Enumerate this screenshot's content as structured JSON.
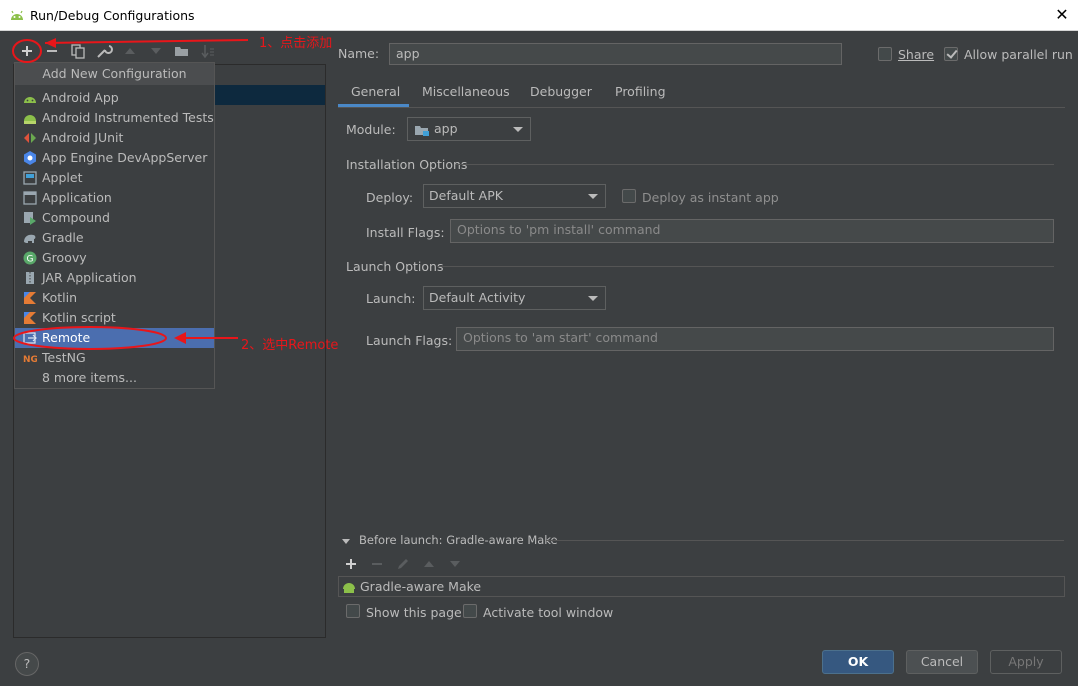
{
  "window": {
    "title": "Run/Debug Configurations",
    "close_icon": "close-icon"
  },
  "toolbar": {
    "icons": [
      "add-icon",
      "remove-icon",
      "copy-icon",
      "wrench-icon",
      "move-up-icon",
      "move-down-icon",
      "folder-icon",
      "sort-icon"
    ]
  },
  "popup": {
    "title": "Add New Configuration",
    "items": [
      {
        "label": "Android App",
        "icon": "android-icon"
      },
      {
        "label": "Android Instrumented Tests",
        "icon": "android-test-icon"
      },
      {
        "label": "Android JUnit",
        "icon": "junit-icon"
      },
      {
        "label": "App Engine DevAppServer",
        "icon": "app-engine-icon"
      },
      {
        "label": "Applet",
        "icon": "applet-icon"
      },
      {
        "label": "Application",
        "icon": "application-icon"
      },
      {
        "label": "Compound",
        "icon": "compound-icon"
      },
      {
        "label": "Gradle",
        "icon": "gradle-icon"
      },
      {
        "label": "Groovy",
        "icon": "groovy-icon"
      },
      {
        "label": "JAR Application",
        "icon": "jar-icon"
      },
      {
        "label": "Kotlin",
        "icon": "kotlin-icon"
      },
      {
        "label": "Kotlin script",
        "icon": "kotlin-script-icon"
      },
      {
        "label": "Remote",
        "icon": "remote-icon"
      },
      {
        "label": "TestNG",
        "icon": "testng-icon"
      },
      {
        "label": "8 more items...",
        "icon": ""
      }
    ]
  },
  "config": {
    "name_label": "Name:",
    "name_value": "app",
    "share_label": "Share",
    "allow_parallel_label": "Allow parallel run",
    "tabs": [
      "General",
      "Miscellaneous",
      "Debugger",
      "Profiling"
    ],
    "module_label": "Module:",
    "module_value": "app",
    "installation_options": "Installation Options",
    "deploy_label": "Deploy:",
    "deploy_value": "Default APK",
    "deploy_instant_label": "Deploy as instant app",
    "install_flags_label": "Install Flags:",
    "install_flags_placeholder": "Options to 'pm install' command",
    "launch_options": "Launch Options",
    "launch_label": "Launch:",
    "launch_value": "Default Activity",
    "launch_flags_label": "Launch Flags:",
    "launch_flags_placeholder": "Options to 'am start' command",
    "before_launch": "Before launch: Gradle-aware Make",
    "before_launch_item": "Gradle-aware Make",
    "show_page_label": "Show this page",
    "activate_tool_label": "Activate tool window"
  },
  "buttons": {
    "ok": "OK",
    "cancel": "Cancel",
    "apply": "Apply",
    "help": "?"
  },
  "annotations": {
    "step1": "1、点击添加",
    "step2": "2、选中Remote",
    "color": "#e8161a"
  },
  "colors": {
    "background": "#3c3f41",
    "selection": "#4b6eaf",
    "primary_button": "#365880",
    "tab_underline": "#4a88c7"
  }
}
